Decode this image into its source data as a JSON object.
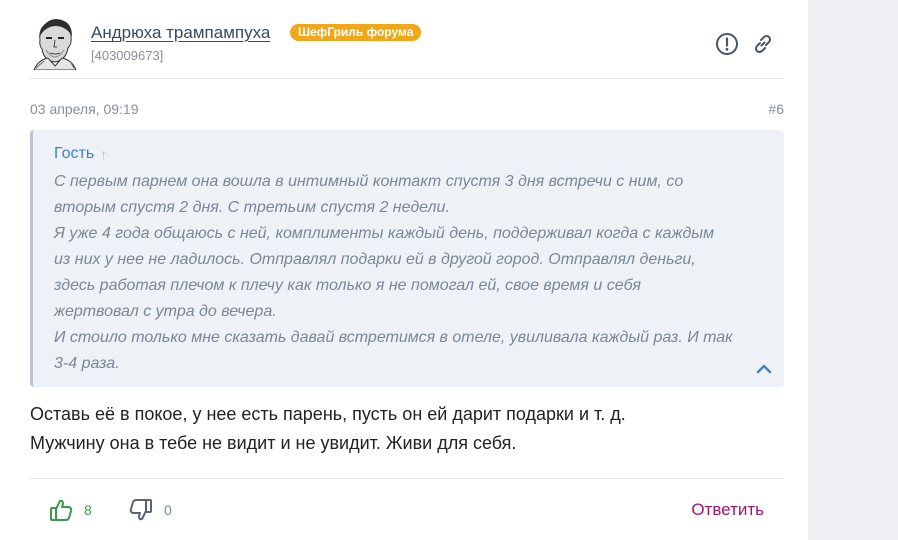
{
  "author": {
    "name": "Андрюха трампампуха",
    "badge": "ШефГриль форума",
    "id": "[403009673]"
  },
  "post": {
    "date": "03 апреля, 09:19",
    "number": "#6"
  },
  "quote": {
    "author": "Гость",
    "lines": [
      "С первым парнем она вошла в интимный контакт спустя 3 дня встречи с ним, со",
      "вторым спустя 2 дня. С третьим спустя 2 недели.",
      "Я уже 4 года общаюсь с ней, комплименты каждый день, поддерживал когда с каждым",
      "из них у нее не ладилось. Отправлял подарки ей в другой город. Отправлял деньги,",
      "здесь работая плечом к плечу как только я не помогал ей, свое время и себя",
      "жертвовал с утра до вечера.",
      "И стоило только мне сказать давай встретимся в отеле, увиливала каждый раз. И так",
      "3-4 раза."
    ]
  },
  "message": {
    "line1": "Оставь её в покое, у нее есть парень, пусть он ей дарит подарки и т. д.",
    "line2": "Мужчину она в тебе не видит и не увидит. Живи для себя."
  },
  "reactions": {
    "likes": "8",
    "dislikes": "0"
  },
  "actions": {
    "reply_label": "Ответить"
  },
  "colors": {
    "badge": "#f0a81a",
    "quote_author": "#3e82c9",
    "like": "#3a9a4a",
    "reply": "#a3166b"
  }
}
